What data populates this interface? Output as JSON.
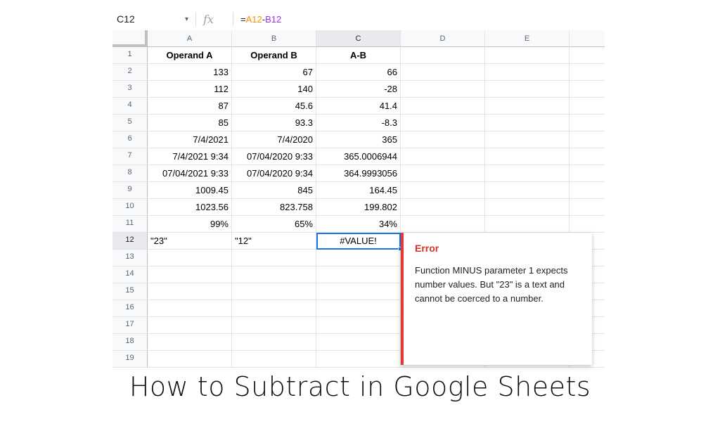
{
  "formula_bar": {
    "name_box": "C12",
    "dropdown_glyph": "▾",
    "fx_label": "fx",
    "formula_eq": "=",
    "formula_ref1": "A12",
    "formula_op": "-",
    "formula_ref2": "B12"
  },
  "columns": [
    "A",
    "B",
    "C",
    "D",
    "E"
  ],
  "rows": [
    "1",
    "2",
    "3",
    "4",
    "5",
    "6",
    "7",
    "8",
    "9",
    "10",
    "11",
    "12",
    "13",
    "14",
    "15",
    "16",
    "17",
    "18",
    "19"
  ],
  "cells": {
    "r1": {
      "a": "Operand A",
      "b": "Operand B",
      "c": "A-B"
    },
    "r2": {
      "a": "133",
      "b": "67",
      "c": "66"
    },
    "r3": {
      "a": "112",
      "b": "140",
      "c": "-28"
    },
    "r4": {
      "a": "87",
      "b": "45.6",
      "c": "41.4"
    },
    "r5": {
      "a": "85",
      "b": "93.3",
      "c": "-8.3"
    },
    "r6": {
      "a": "7/4/2021",
      "b": "7/4/2020",
      "c": "365"
    },
    "r7": {
      "a": "7/4/2021 9:34",
      "b": "07/04/2020 9:33",
      "c": "365.0006944"
    },
    "r8": {
      "a": "07/04/2021 9:33",
      "b": "07/04/2020 9:34",
      "c": "364.9993056"
    },
    "r9": {
      "a": "1009.45",
      "b": "845",
      "c": "164.45"
    },
    "r10": {
      "a": "1023.56",
      "b": "823.758",
      "c": "199.802"
    },
    "r11": {
      "a": "99%",
      "b": "65%",
      "c": "34%"
    },
    "r12": {
      "a": "\"23\"",
      "b": "\"12\"",
      "c": "#VALUE!"
    }
  },
  "error_popup": {
    "title": "Error",
    "message": "Function MINUS parameter 1 expects number values. But \"23\" is a text and cannot be coerced to a number."
  },
  "caption": "How to Subtract in Google Sheets",
  "colors": {
    "accent": "#1a73e8",
    "error": "#d93025",
    "ref1": "#f09300",
    "ref2": "#9334e6"
  }
}
